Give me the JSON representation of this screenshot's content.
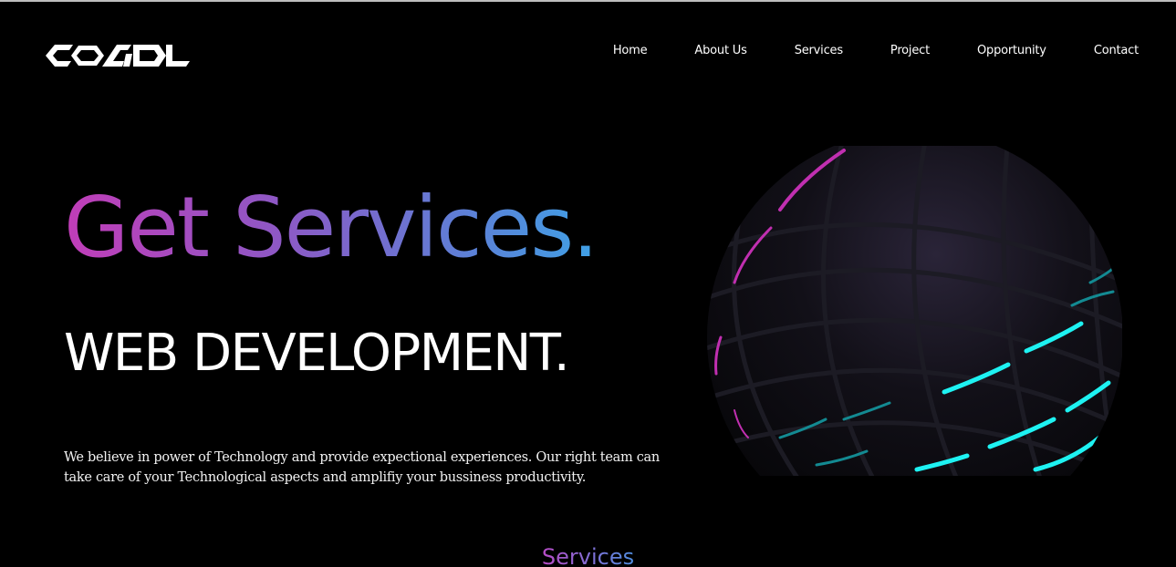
{
  "header": {
    "logo_text": "COADL",
    "logo_icon": "coadl-logo",
    "nav": [
      {
        "label": "Home"
      },
      {
        "label": "About Us"
      },
      {
        "label": "Services"
      },
      {
        "label": "Project"
      },
      {
        "label": "Opportunity"
      },
      {
        "label": "Contact"
      }
    ]
  },
  "hero": {
    "title": "Get Services.",
    "subtitle": "WEB DEVELOPMENT.",
    "description": "We believe in power of Technology and provide expectional experiences. Our right team can take care of your Technological aspects and amplifiy your bussiness productivity.",
    "image_icon": "sphere-image"
  },
  "services": {
    "heading": "Services"
  },
  "colors": {
    "background": "#000000",
    "gradient_start": "#c13db8",
    "gradient_end": "#3fa1e6",
    "accent_cyan": "#1ef2f2",
    "accent_magenta": "#c02fb0"
  }
}
